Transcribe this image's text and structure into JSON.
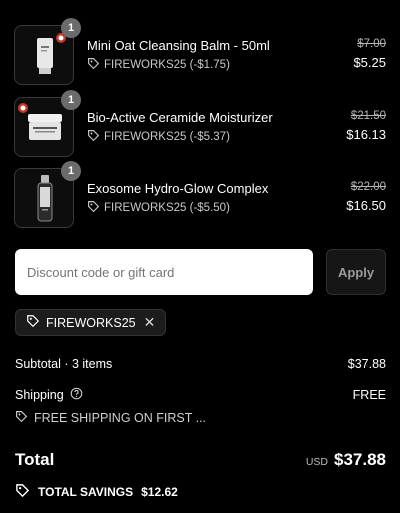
{
  "items": [
    {
      "name": "Mini Oat Cleansing Balm - 50ml",
      "qty": "1",
      "discount": "FIREWORKS25 (-$1.75)",
      "original_price": "$7.00",
      "final_price": "$5.25"
    },
    {
      "name": "Bio-Active Ceramide Moisturizer",
      "qty": "1",
      "discount": "FIREWORKS25 (-$5.37)",
      "original_price": "$21.50",
      "final_price": "$16.13"
    },
    {
      "name": "Exosome Hydro-Glow Complex",
      "qty": "1",
      "discount": "FIREWORKS25 (-$5.50)",
      "original_price": "$22.00",
      "final_price": "$16.50"
    }
  ],
  "discount": {
    "placeholder": "Discount code or gift card",
    "apply_label": "Apply",
    "applied_code": "FIREWORKS25",
    "remove_symbol": "✕"
  },
  "summary": {
    "subtotal_label": "Subtotal · 3 items",
    "subtotal_value": "$37.88",
    "shipping_label": "Shipping",
    "shipping_value": "FREE",
    "shipping_promo": "FREE SHIPPING ON FIRST ...",
    "total_label": "Total",
    "currency": "USD",
    "total_value": "$37.88",
    "savings_label": "TOTAL SAVINGS",
    "savings_value": "$12.62"
  },
  "colors": {
    "background": "#000000",
    "input_bg": "#ffffff",
    "badge": "#6b6b6b"
  }
}
